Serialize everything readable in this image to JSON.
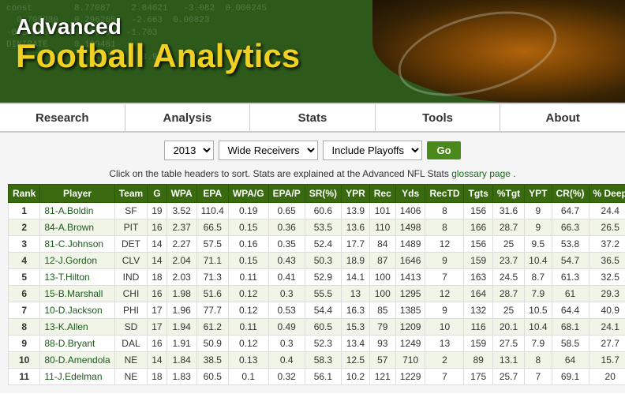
{
  "header": {
    "title_advanced": "Advanced",
    "title_main": "Football Analytics",
    "bg_numbers": "const        8.77087    2.84621   -3.082  0.000245\n  0.799930   0.296265   -2.663  0.00823\n-0.555964   0.326639   -1.703\nDINIRATE     0.199481\n                64.7     -3.9"
  },
  "nav": {
    "items": [
      {
        "label": "Research",
        "id": "research"
      },
      {
        "label": "Analysis",
        "id": "analysis"
      },
      {
        "label": "Stats",
        "id": "stats"
      },
      {
        "label": "Tools",
        "id": "tools"
      },
      {
        "label": "About",
        "id": "about"
      }
    ]
  },
  "controls": {
    "year": "2013",
    "year_options": [
      "2013"
    ],
    "position": "Wide Receivers",
    "position_options": [
      "Wide Receivers"
    ],
    "playoff": "Include Playoffs",
    "playoff_options": [
      "Include Playoffs"
    ],
    "go_label": "Go"
  },
  "info": {
    "text1": "Click on the table headers to sort. Stats are explained at the Advanced NFL Stats",
    "glossary_link": "glossary page",
    "text2": "."
  },
  "table": {
    "headers": [
      "Rank",
      "Player",
      "Team",
      "G",
      "WPA",
      "EPA",
      "WPA/G",
      "EPA/P",
      "SR(%)",
      "YPR",
      "Rec",
      "Yds",
      "RecTD",
      "Tgts",
      "%Tgt",
      "YPT",
      "CR(%)",
      "% Deep"
    ],
    "rows": [
      [
        1,
        "81-A.Boldin",
        "SF",
        19,
        3.52,
        110.4,
        0.19,
        0.65,
        60.6,
        13.9,
        101,
        1406,
        8,
        156,
        31.6,
        9.0,
        64.7,
        24.4
      ],
      [
        2,
        "84-A.Brown",
        "PIT",
        16,
        2.37,
        66.5,
        0.15,
        0.36,
        53.5,
        13.6,
        110,
        1498,
        8,
        166,
        28.7,
        9.0,
        66.3,
        26.5
      ],
      [
        3,
        "81-C.Johnson",
        "DET",
        14,
        2.27,
        57.5,
        0.16,
        0.35,
        52.4,
        17.7,
        84,
        1489,
        12,
        156,
        25.0,
        9.5,
        53.8,
        37.2
      ],
      [
        4,
        "12-J.Gordon",
        "CLV",
        14,
        2.04,
        71.1,
        0.15,
        0.43,
        50.3,
        18.9,
        87,
        1646,
        9,
        159,
        23.7,
        10.4,
        54.7,
        36.5
      ],
      [
        5,
        "13-T.Hilton",
        "IND",
        18,
        2.03,
        71.3,
        0.11,
        0.41,
        52.9,
        14.1,
        100,
        1413,
        7,
        163,
        24.5,
        8.7,
        61.3,
        32.5
      ],
      [
        6,
        "15-B.Marshall",
        "CHI",
        16,
        1.98,
        51.6,
        0.12,
        0.3,
        55.5,
        13.0,
        100,
        1295,
        12,
        164,
        28.7,
        7.9,
        61.0,
        29.3
      ],
      [
        7,
        "10-D.Jackson",
        "PHI",
        17,
        1.96,
        77.7,
        0.12,
        0.53,
        54.4,
        16.3,
        85,
        1385,
        9,
        132,
        25.0,
        10.5,
        64.4,
        40.9
      ],
      [
        8,
        "13-K.Allen",
        "SD",
        17,
        1.94,
        61.2,
        0.11,
        0.49,
        60.5,
        15.3,
        79,
        1209,
        10,
        116,
        20.1,
        10.4,
        68.1,
        24.1
      ],
      [
        9,
        "88-D.Bryant",
        "DAL",
        16,
        1.91,
        50.9,
        0.12,
        0.3,
        52.3,
        13.4,
        93,
        1249,
        13,
        159,
        27.5,
        7.9,
        58.5,
        27.7
      ],
      [
        10,
        "80-D.Amendola",
        "NE",
        14,
        1.84,
        38.5,
        0.13,
        0.4,
        58.3,
        12.5,
        57,
        710,
        2,
        89,
        13.1,
        8.0,
        64.0,
        15.7
      ],
      [
        11,
        "11-J.Edelman",
        "NE",
        18,
        1.83,
        60.5,
        0.1,
        0.32,
        56.1,
        10.2,
        121,
        1229,
        7,
        175,
        25.7,
        7.0,
        69.1,
        20.0
      ]
    ],
    "player_link_color": "#1a5a1a"
  }
}
